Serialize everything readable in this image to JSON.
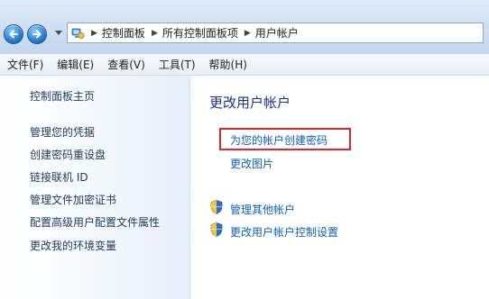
{
  "address_bar": {
    "breadcrumbs": [
      "控制面板",
      "所有控制面板项",
      "用户帐户"
    ]
  },
  "menu": {
    "items": [
      "文件(F)",
      "编辑(E)",
      "查看(V)",
      "工具(T)",
      "帮助(H)"
    ]
  },
  "sidebar": {
    "home_link": "控制面板主页",
    "links": [
      "管理您的凭据",
      "创建密码重设盘",
      "链接联机 ID",
      "管理文件加密证书",
      "配置高级用户配置文件属性",
      "更改我的环境变量"
    ]
  },
  "main": {
    "title": "更改用户帐户",
    "create_password": "为您的帐户创建密码",
    "change_picture": "更改图片",
    "manage_other": "管理其他帐户",
    "uac_settings": "更改用户帐户控制设置"
  },
  "colors": {
    "link": "#0d5fbf",
    "title": "#1e3287",
    "highlight_border": "#e0262c"
  },
  "icons": {
    "back": "back-arrow-icon",
    "forward": "forward-arrow-icon",
    "location": "control-panel-icon",
    "admin": "uac-shield-icon"
  }
}
